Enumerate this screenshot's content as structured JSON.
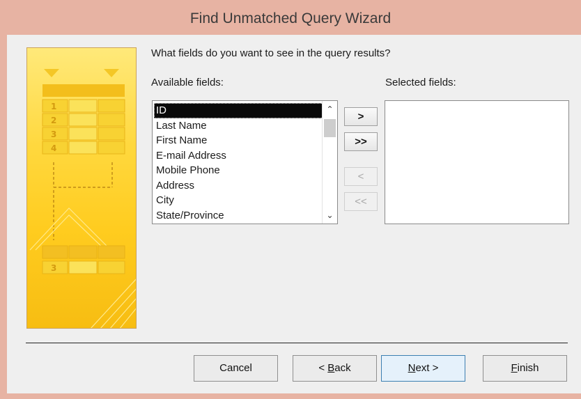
{
  "window": {
    "title": "Find Unmatched Query Wizard"
  },
  "question": "What fields do you want to see in the query results?",
  "available": {
    "label": "Available fields:",
    "items": [
      "ID",
      "Last Name",
      "First Name",
      "E-mail Address",
      "Mobile Phone",
      "Address",
      "City",
      "State/Province"
    ],
    "selected_item": "ID"
  },
  "selected": {
    "label": "Selected fields:",
    "items": []
  },
  "move_buttons": {
    "add_one": ">",
    "add_all": ">>",
    "remove_one": "<",
    "remove_all": "<<"
  },
  "illustration": {
    "row_numbers": [
      "1",
      "2",
      "3",
      "4"
    ],
    "result_row_number": "3"
  },
  "footer": {
    "cancel": "Cancel",
    "back_prefix": "< ",
    "back_mnemonic": "B",
    "back_rest": "ack",
    "next_mnemonic": "N",
    "next_rest": "ext >",
    "finish_mnemonic": "F",
    "finish_rest": "inish"
  },
  "colors": {
    "title_bar": "#e7b3a3",
    "illustration": "#ffd83e",
    "list_highlight": "#0a0a0a"
  }
}
